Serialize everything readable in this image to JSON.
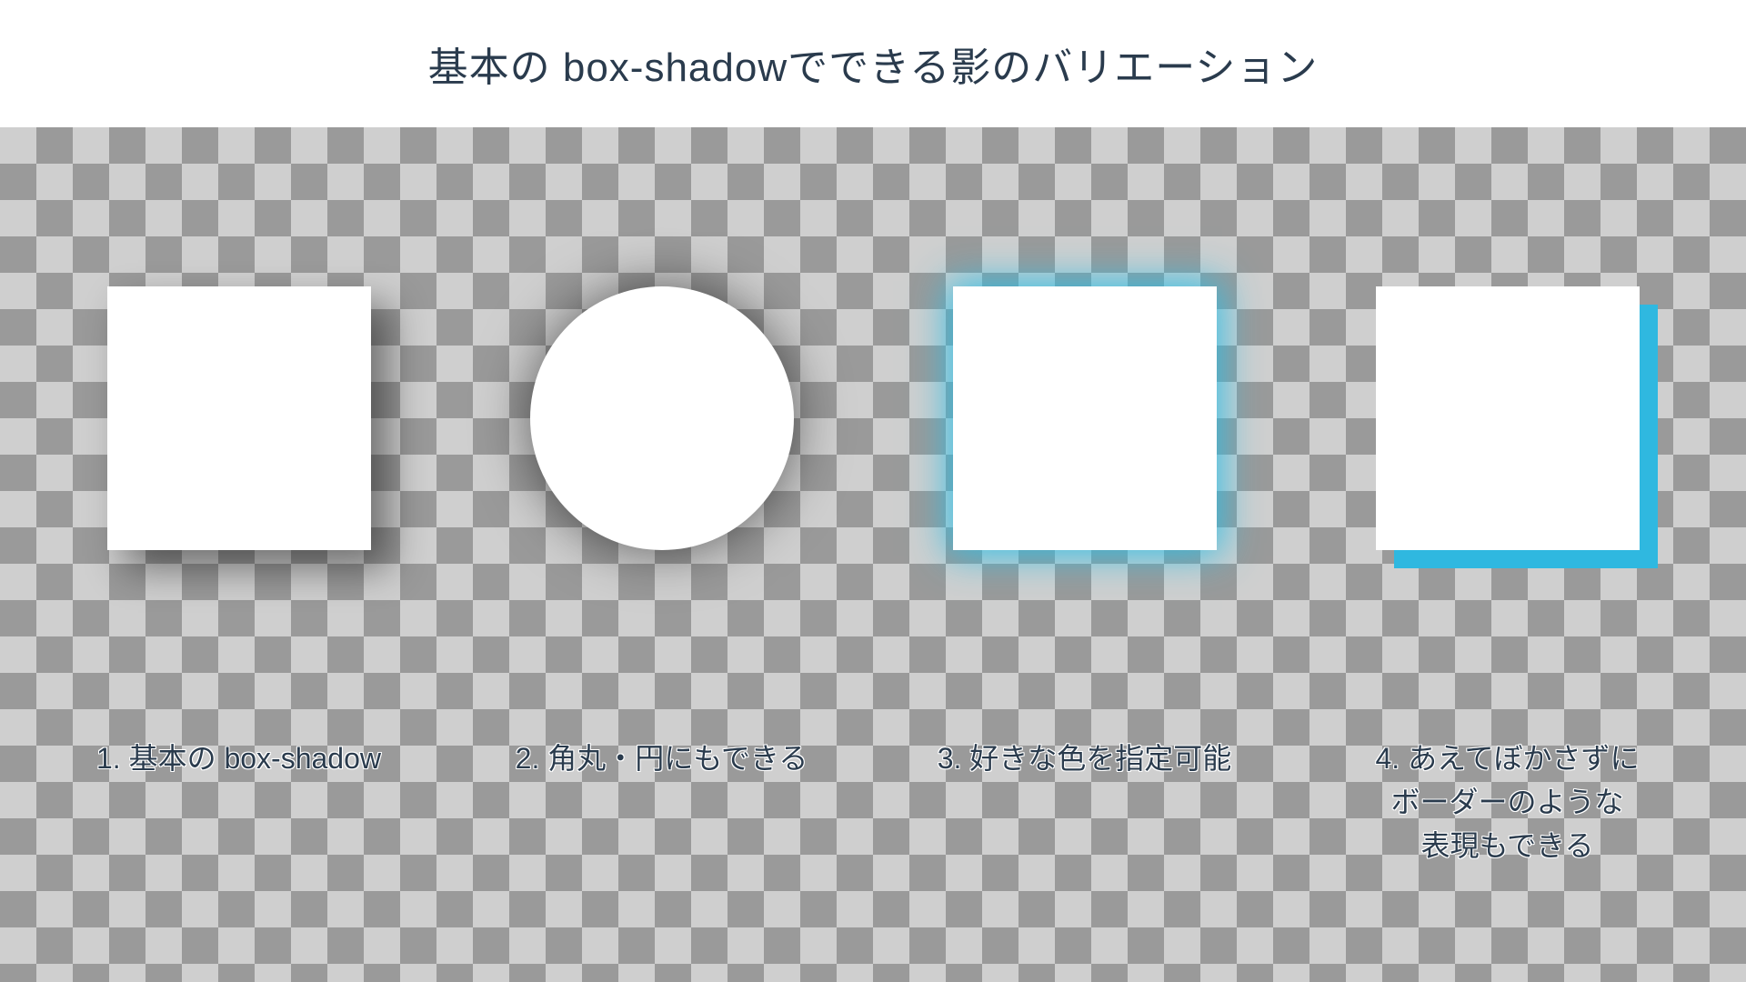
{
  "page_title": "基本の box-shadowでできる影のバリエーション",
  "examples": [
    {
      "caption": "1. 基本の box-shadow"
    },
    {
      "caption": "2. 角丸・円にもできる"
    },
    {
      "caption": "3. 好きな色を指定可能"
    },
    {
      "caption": "4. あえてぼかさずに\nボーダーのような\n表現もできる"
    }
  ]
}
